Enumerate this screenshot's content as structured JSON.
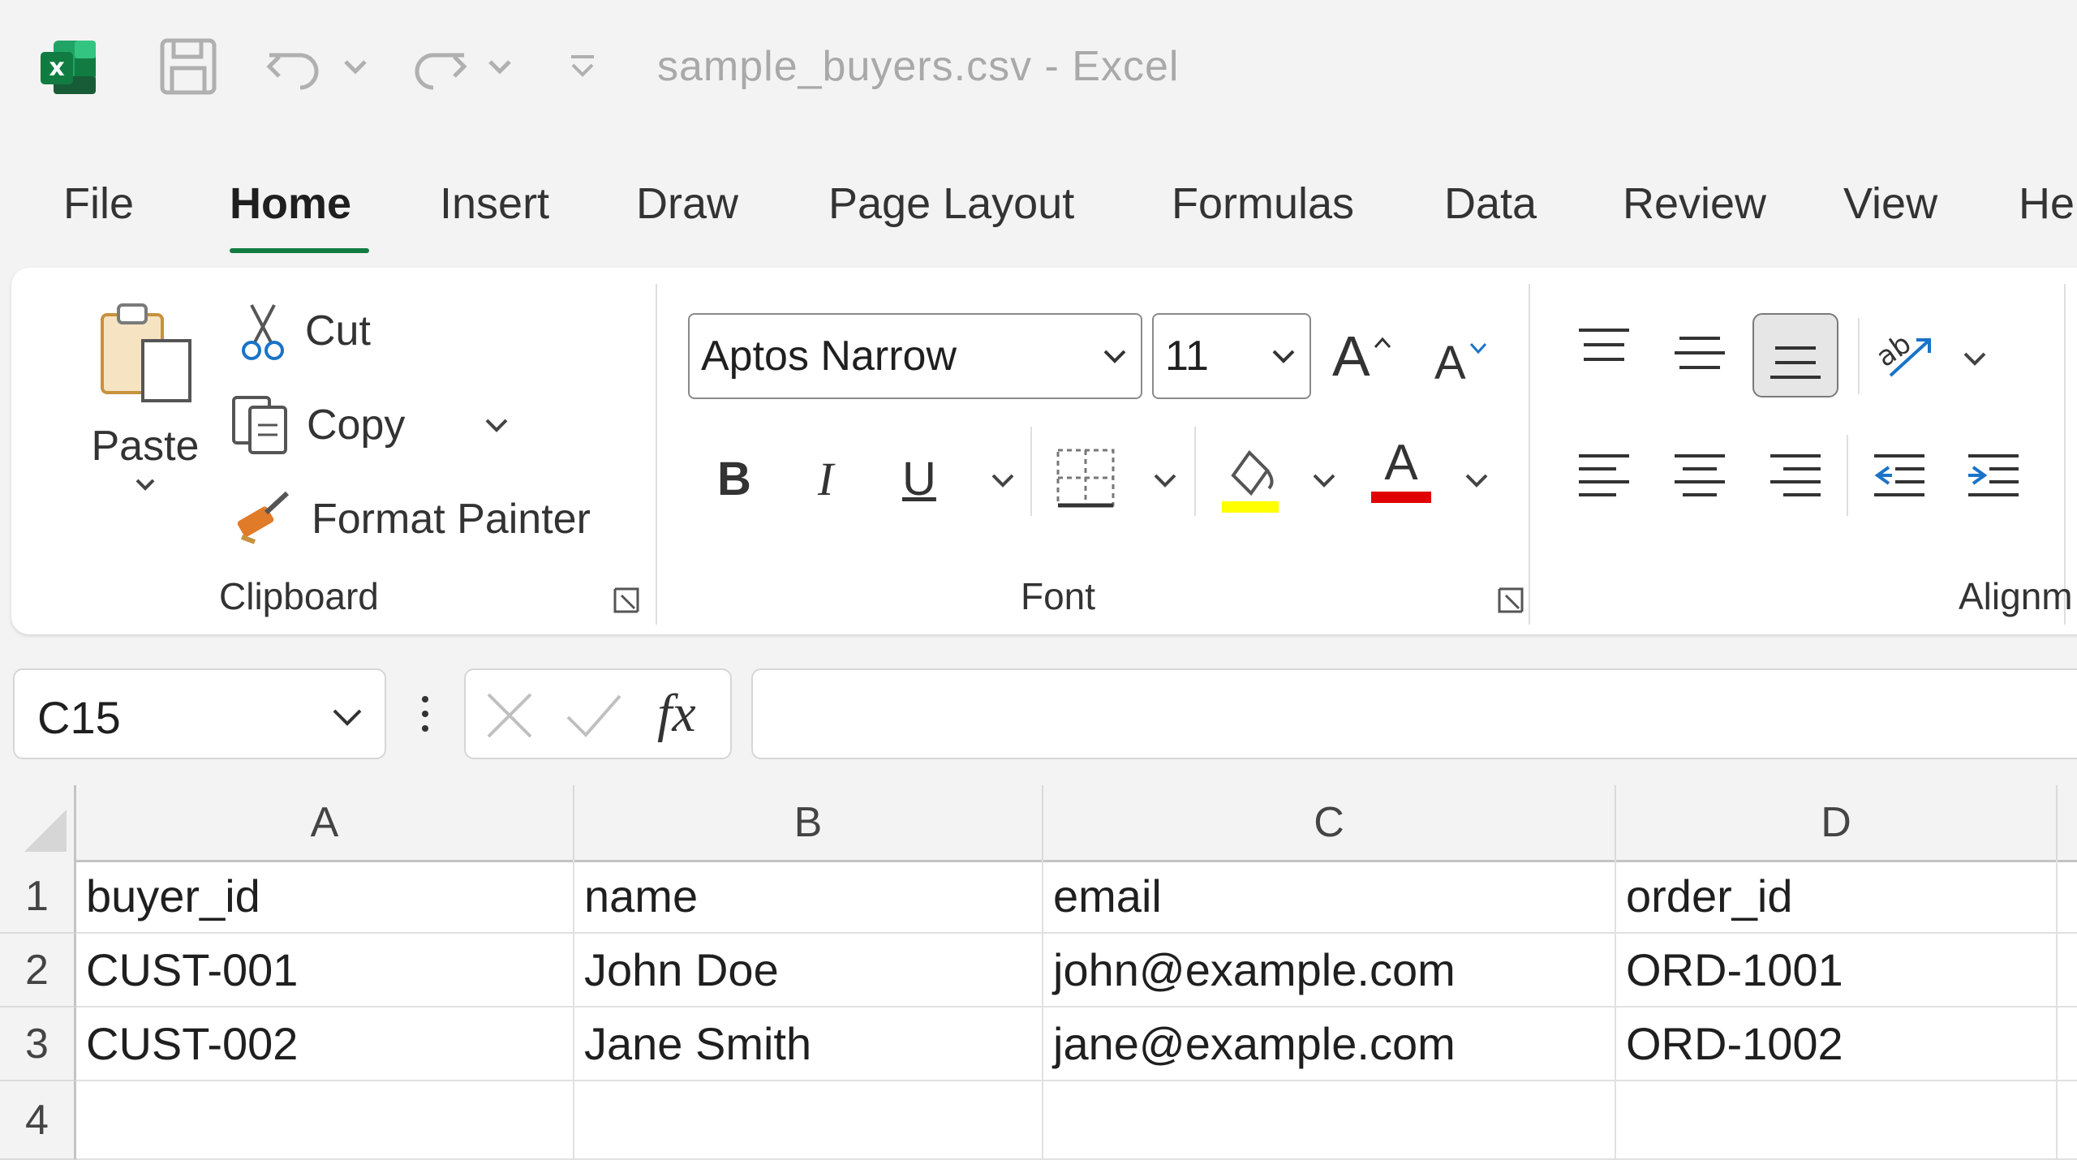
{
  "titlebar": {
    "document_title": "sample_buyers.csv  -  Excel",
    "app_icon_letter": "x"
  },
  "tabs": [
    "File",
    "Home",
    "Insert",
    "Draw",
    "Page Layout",
    "Formulas",
    "Data",
    "Review",
    "View",
    "He"
  ],
  "active_tab": "Home",
  "ribbon": {
    "clipboard": {
      "paste": "Paste",
      "cut": "Cut",
      "copy": "Copy",
      "format_painter": "Format Painter",
      "label": "Clipboard"
    },
    "font": {
      "font_name": "Aptos Narrow",
      "font_size": "11",
      "grow_glyph": "A",
      "shrink_glyph": "A",
      "bold": "B",
      "italic": "I",
      "underline": "U",
      "font_color_glyph": "A",
      "highlight_color": "#ffff00",
      "font_color": "#e00000",
      "label": "Font"
    },
    "alignment": {
      "label": "Alignm"
    }
  },
  "formula_bar": {
    "name_box": "C15",
    "fx": "fx",
    "formula": ""
  },
  "sheet": {
    "columns": [
      "A",
      "B",
      "C",
      "D"
    ],
    "row_numbers": [
      "1",
      "2",
      "3",
      "4"
    ],
    "rows": [
      [
        "buyer_id",
        "name",
        "email",
        "order_id"
      ],
      [
        "CUST-001",
        "John Doe",
        "john@example.com",
        "ORD-1001"
      ],
      [
        "CUST-002",
        "Jane Smith",
        "jane@example.com",
        "ORD-1002"
      ],
      [
        "",
        "",
        "",
        ""
      ]
    ]
  },
  "colors": {
    "accent": "#107c41",
    "excel_green": "#1d6f42"
  }
}
